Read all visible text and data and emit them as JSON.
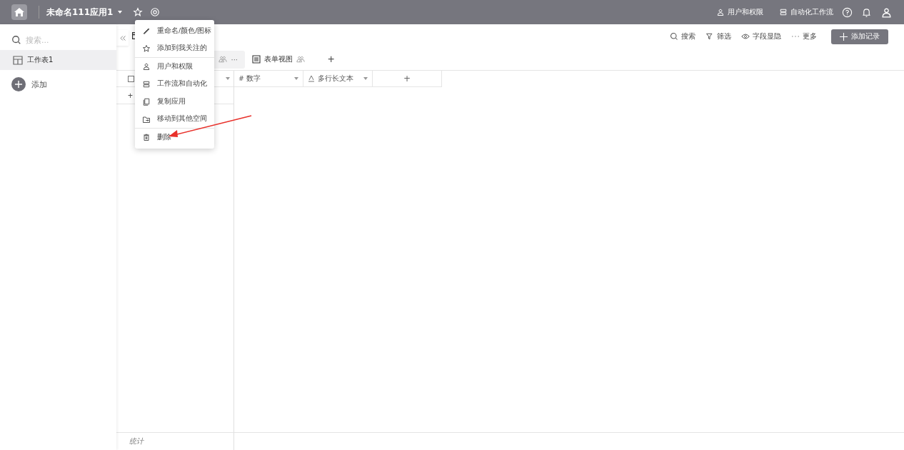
{
  "topbar": {
    "app_name": "未命名111应用1",
    "links": [
      "用户和权限",
      "自动化工作流"
    ]
  },
  "sidebar": {
    "search_placeholder": "搜索...",
    "items": [
      {
        "label": "工作表1",
        "selected": true
      }
    ],
    "add_label": "添加"
  },
  "toolbar": {
    "actions": [
      "搜索",
      "筛选",
      "字段显隐",
      "更多"
    ],
    "add_record": "添加记录"
  },
  "views": [
    {
      "label": "···",
      "selected": true
    },
    {
      "label": "表单视图",
      "selected": false
    }
  ],
  "columns": [
    {
      "label": "# 数字"
    },
    {
      "label": "多行长文本"
    }
  ],
  "add_row": "+",
  "add_column": "+",
  "add_view": "+",
  "footer": {
    "label": "统计"
  },
  "menu": [
    {
      "items": [
        "重命名/颜色/图标",
        "添加到我关注的"
      ]
    },
    {
      "items": [
        "用户和权限",
        "工作流和自动化",
        "复制应用",
        "移动到其他空间"
      ]
    },
    {
      "items": [
        "删除"
      ]
    }
  ]
}
